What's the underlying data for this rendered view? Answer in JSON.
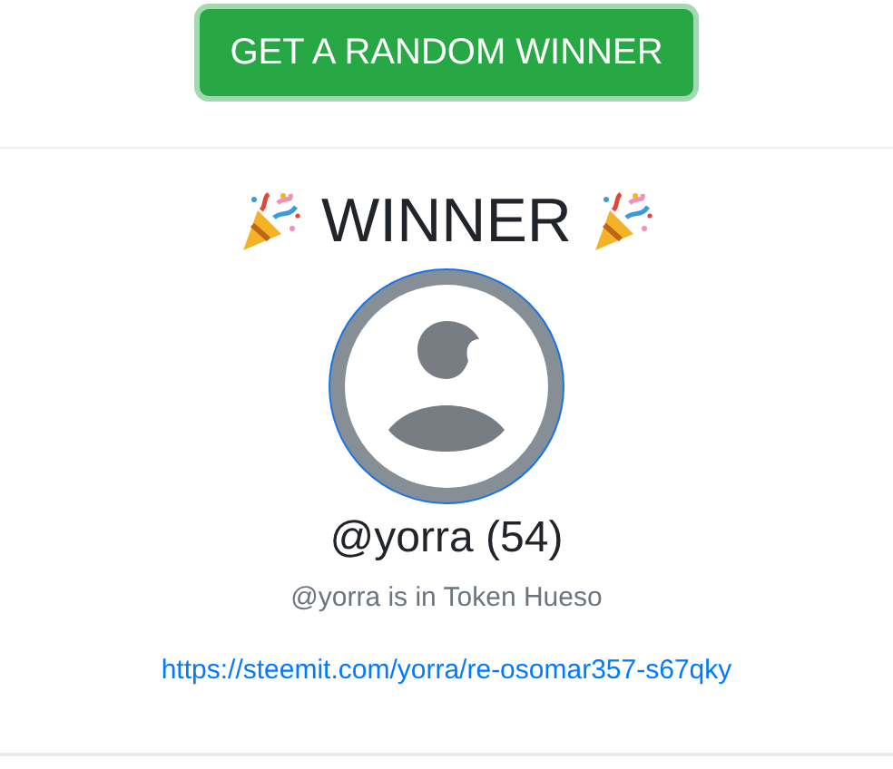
{
  "action_button": {
    "label": "GET A RANDOM WINNER"
  },
  "winner": {
    "heading": "WINNER",
    "username": "@yorra (54)",
    "community_note": "@yorra is in Token Hueso",
    "link": "https://steemit.com/yorra/re-osomar357-s67qky"
  }
}
